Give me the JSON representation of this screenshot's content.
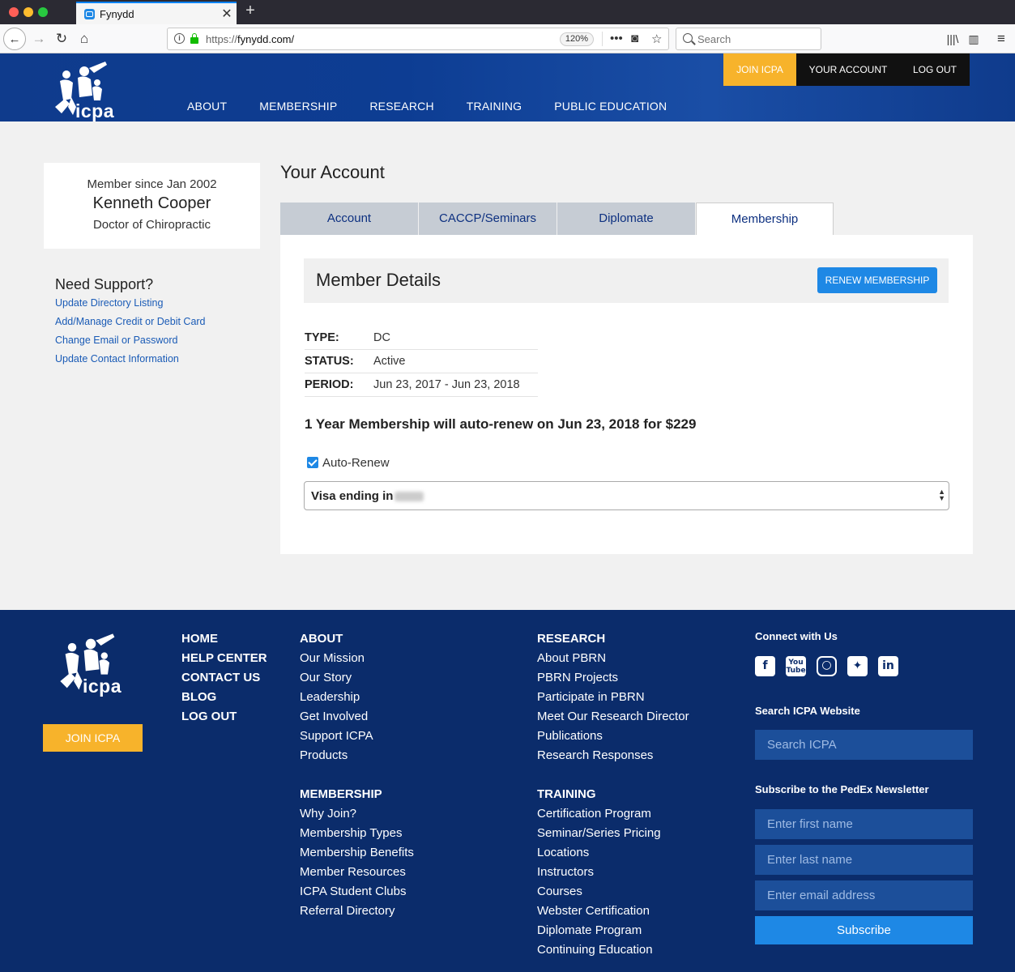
{
  "browser": {
    "tab_title": "Fynydd",
    "url_scheme": "https://",
    "url_host": "fynydd.com/",
    "zoom": "120%",
    "search_placeholder": "Search"
  },
  "header": {
    "logo_text": "icpa",
    "nav": [
      "ABOUT",
      "MEMBERSHIP",
      "RESEARCH",
      "TRAINING",
      "PUBLIC EDUCATION"
    ],
    "join_label": "JOIN ICPA",
    "account_label": "YOUR ACCOUNT",
    "logout_label": "LOG OUT"
  },
  "profile": {
    "member_since": "Member since Jan 2002",
    "name": "Kenneth Cooper",
    "role": "Doctor of Chiropractic"
  },
  "support": {
    "title": "Need Support?",
    "links": [
      "Update Directory Listing",
      "Add/Manage Credit or Debit Card",
      "Change Email or Password",
      "Update Contact Information"
    ]
  },
  "account": {
    "title": "Your Account",
    "tabs": [
      "Account",
      "CACCP/Seminars",
      "Diplomate",
      "Membership"
    ],
    "active_tab": "Membership",
    "member_details_title": "Member Details",
    "renew_label": "RENEW MEMBERSHIP",
    "details": [
      {
        "key": "TYPE:",
        "value": "DC"
      },
      {
        "key": "STATUS:",
        "value": "Active"
      },
      {
        "key": "PERIOD:",
        "value": "Jun 23, 2017 - Jun 23, 2018"
      }
    ],
    "autorenew_message": "1 Year Membership will auto-renew on Jun 23, 2018 for $229",
    "autorenew_label": "Auto-Renew",
    "autorenew_checked": true,
    "card_select_text": "Visa ending in"
  },
  "footer": {
    "logo_text": "icpa",
    "join_label": "JOIN ICPA",
    "main_links": [
      "HOME",
      "HELP CENTER",
      "CONTACT US",
      "BLOG",
      "LOG OUT"
    ],
    "about": {
      "heading": "ABOUT",
      "links": [
        "Our Mission",
        "Our Story",
        "Leadership",
        "Get Involved",
        "Support ICPA",
        "Products"
      ]
    },
    "membership": {
      "heading": "MEMBERSHIP",
      "links": [
        "Why Join?",
        "Membership Types",
        "Membership Benefits",
        "Member Resources",
        "ICPA Student Clubs",
        "Referral Directory"
      ]
    },
    "research": {
      "heading": "RESEARCH",
      "links": [
        "About PBRN",
        "PBRN Projects",
        "Participate in PBRN",
        "Meet Our Research Director",
        "Publications",
        "Research Responses"
      ]
    },
    "training": {
      "heading": "TRAINING",
      "links": [
        "Certification Program",
        "Seminar/Series Pricing",
        "Locations",
        "Instructors",
        "Courses",
        "Webster Certification",
        "Diplomate Program",
        "Continuing Education"
      ]
    },
    "connect_title": "Connect with Us",
    "socials": [
      "facebook-icon",
      "youtube-icon",
      "instagram-icon",
      "twitter-icon",
      "linkedin-icon"
    ],
    "search_title": "Search ICPA Website",
    "search_placeholder": "Search ICPA",
    "newsletter_title": "Subscribe to the PedEx Newsletter",
    "first_name_placeholder": "Enter first name",
    "last_name_placeholder": "Enter last name",
    "email_placeholder": "Enter email address",
    "subscribe_label": "Subscribe"
  },
  "colors": {
    "brand_blue": "#0d3d93",
    "footer_blue": "#0b2c6b",
    "accent_yellow": "#f7b32b",
    "button_blue": "#1e88e5",
    "link_blue": "#1a5bb6"
  }
}
